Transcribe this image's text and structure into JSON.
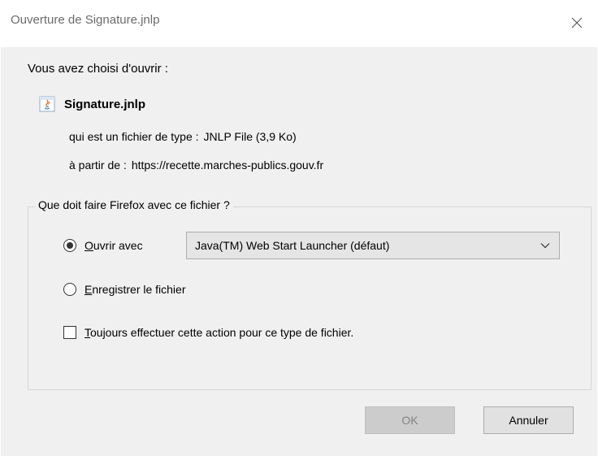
{
  "window": {
    "title": "Ouverture de Signature.jnlp",
    "close_icon": "close-icon"
  },
  "intro_text": "Vous avez choisi d'ouvrir :",
  "file": {
    "icon": "java-file-icon",
    "name": "Signature.jnlp",
    "type_label": "qui est un fichier de type :",
    "type_value": "JNLP File (3,9 Ko)",
    "source_label": "à partir de :",
    "source_value": "https://recette.marches-publics.gouv.fr"
  },
  "action_group": {
    "legend": "Que doit faire Firefox avec ce fichier ?",
    "open_with": {
      "accel": "O",
      "label_rest": "uvrir avec",
      "checked": true
    },
    "application_select": {
      "selected": "Java(TM) Web Start Launcher (défaut)"
    },
    "save_file": {
      "accel": "E",
      "label_rest": "nregistrer le fichier",
      "checked": false
    },
    "always_do": {
      "accel": "T",
      "label_rest": "oujours effectuer cette action pour ce type de fichier.",
      "checked": false
    }
  },
  "buttons": {
    "ok": "OK",
    "cancel": "Annuler"
  },
  "colors": {
    "title_text": "#6b6b6b",
    "body_background": "#f0f0f0",
    "ok_disabled_text": "#838383"
  }
}
